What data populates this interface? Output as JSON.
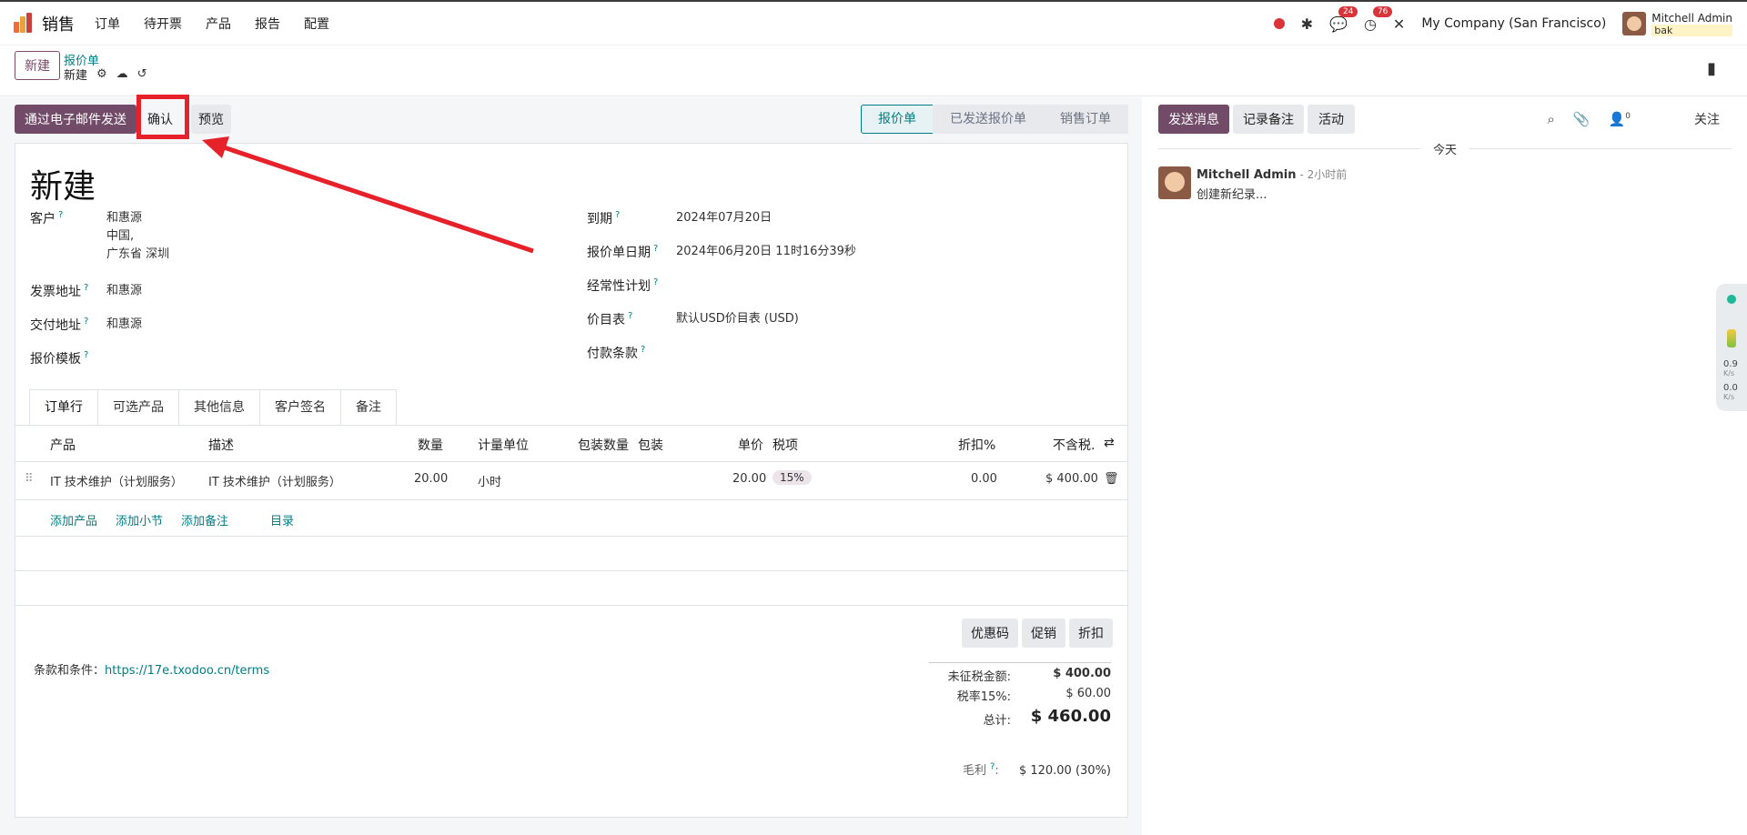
{
  "topbar": {
    "app_name": "销售",
    "menu": [
      "订单",
      "待开票",
      "产品",
      "报告",
      "配置"
    ],
    "messages_count": "24",
    "activities_count": "76",
    "company": "My Company (San Francisco)",
    "user_name": "Mitchell Admin",
    "user_db": "bak"
  },
  "control_panel": {
    "new_label": "新建",
    "breadcrumb_parent": "报价单",
    "breadcrumb_current": "新建"
  },
  "status": {
    "send_email": "通过电子邮件发送",
    "confirm": "确认",
    "preview": "预览",
    "stages": [
      "报价单",
      "已发送报价单",
      "销售订单"
    ],
    "active_stage": "报价单"
  },
  "form": {
    "title": "新建",
    "customer_label": "客户",
    "customer_lines": [
      "和惠源",
      "中国,",
      "广东省 深圳"
    ],
    "invoice_addr_label": "发票地址",
    "invoice_addr": "和惠源",
    "delivery_addr_label": "交付地址",
    "delivery_addr": "和惠源",
    "template_label": "报价模板",
    "expiry_label": "到期",
    "expiry": "2024年07月20日",
    "quote_date_label": "报价单日期",
    "quote_date": "2024年06月20日 11时16分39秒",
    "recurring_label": "经常性计划",
    "pricelist_label": "价目表",
    "pricelist": "默认USD价目表 (USD)",
    "payment_terms_label": "付款条款",
    "help_mark": "?"
  },
  "tabs": [
    "订单行",
    "可选产品",
    "其他信息",
    "客户签名",
    "备注"
  ],
  "lines": {
    "headers": {
      "product": "产品",
      "desc": "描述",
      "qty": "数量",
      "uom": "计量单位",
      "pkg_qty": "包装数量",
      "pkg": "包装",
      "price": "单价",
      "tax": "税项",
      "disc": "折扣%",
      "subtotal": "不含税."
    },
    "row": {
      "product": "IT 技术维护（计划服务）",
      "desc": "IT 技术维护（计划服务）",
      "qty": "20.00",
      "uom": "小时",
      "price": "20.00",
      "tax": "15%",
      "disc": "0.00",
      "subtotal": "$ 400.00"
    },
    "add_product": "添加产品",
    "add_section": "添加小节",
    "add_note": "添加备注",
    "catalog": "目录"
  },
  "footer": {
    "terms_label": "条款和条件：",
    "terms_link": "https://17e.txodoo.cn/terms",
    "coupon": "优惠码",
    "promo": "促销",
    "discount": "折扣",
    "untaxed_label": "未征税金额:",
    "untaxed": "$ 400.00",
    "tax_label": "税率15%:",
    "tax": "$ 60.00",
    "total_label": "总计:",
    "total": "$ 460.00",
    "margin_label": "毛利",
    "margin": "$ 120.00 (30%)"
  },
  "chatter": {
    "send_message": "发送消息",
    "log_note": "记录备注",
    "activity": "活动",
    "followers_count": "0",
    "follow": "关注",
    "today": "今天",
    "author": "Mitchell Admin",
    "time": "- 2小时前",
    "body": "创建新纪录..."
  },
  "side_widget": {
    "up": "0.9",
    "down": "0.0",
    "unit": "K/s"
  },
  "colors": {
    "primary": "#714b67",
    "accent": "#017e84",
    "annotation": "#e62129"
  }
}
